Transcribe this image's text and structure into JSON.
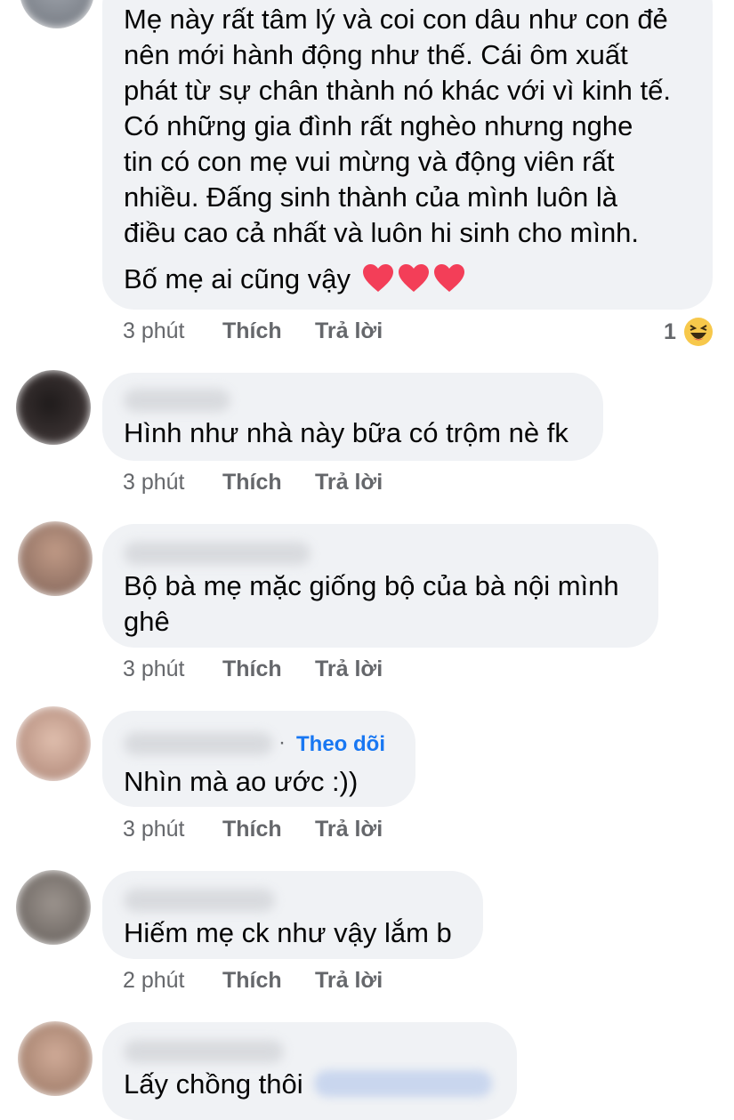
{
  "comments": [
    {
      "lines": [
        "Mẹ này rất tâm lý và coi con dâu như con đẻ",
        "nên mới hành động như thế. Cái ôm xuất",
        "phát từ sự chân thành nó khác với vì kinh tế.",
        "Có những gia đình rất nghèo nhưng nghe",
        "tin có con mẹ vui mừng và động viên rất",
        "nhiều. Đấng sinh thành của mình luôn là",
        "điều cao cả nhất và luôn hi sinh cho mình."
      ],
      "last_line": "Bố mẹ ai cũng vậy",
      "time": "3 phút",
      "like": "Thích",
      "reply": "Trả lời",
      "reaction_count": "1",
      "reaction_icon": "haha-icon",
      "avatar_color": "#8a8f99"
    },
    {
      "text": "Hình như nhà này bữa có trộm nè fk",
      "time": "3 phút",
      "like": "Thích",
      "reply": "Trả lời",
      "avatar_color": "#2a2626"
    },
    {
      "lines": [
        "Bộ bà mẹ mặc giống bộ của bà nội mình",
        "ghê"
      ],
      "time": "3 phút",
      "like": "Thích",
      "reply": "Trả lời",
      "avatar_color": "#a08270"
    },
    {
      "text": "Nhìn mà ao ước :))",
      "follow_sep": "·",
      "follow": "Theo dõi",
      "time": "3 phút",
      "like": "Thích",
      "reply": "Trả lời",
      "avatar_color": "#c09a8c"
    },
    {
      "text": "Hiếm mẹ ck như vậy lắm b",
      "time": "2 phút",
      "like": "Thích",
      "reply": "Trả lời",
      "avatar_color": "#7a7470"
    },
    {
      "text": "Lấy chồng thôi",
      "avatar_color": "#b89684"
    }
  ],
  "colors": {
    "bubble": "#f0f2f5",
    "text": "#050505",
    "meta": "#65676b",
    "link": "#1877f2",
    "heart": "#f33e58"
  }
}
